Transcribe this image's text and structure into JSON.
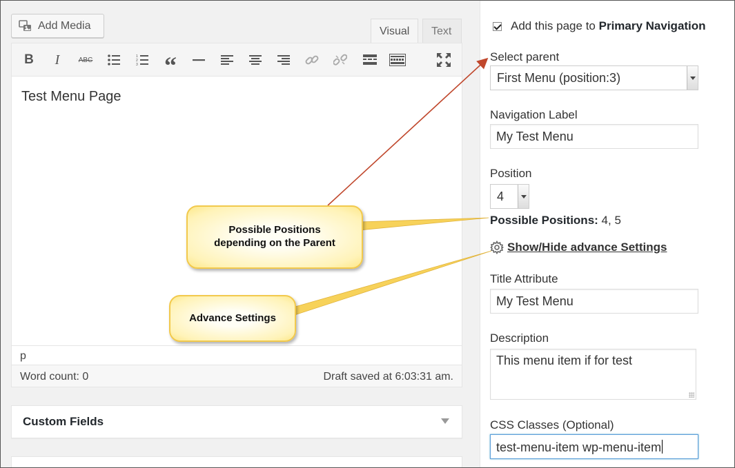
{
  "editor": {
    "add_media_label": "Add Media",
    "tabs": {
      "visual": "Visual",
      "text": "Text"
    },
    "toolbar": {
      "bold": "B",
      "italic": "I",
      "strikethrough": "ABC",
      "blockquote": "“",
      "icons": [
        "bold-icon",
        "italic-icon",
        "strikethrough-icon",
        "bullet-list-icon",
        "numbered-list-icon",
        "blockquote-icon",
        "horizontal-rule-icon",
        "align-left-icon",
        "align-center-icon",
        "align-right-icon",
        "link-icon",
        "unlink-icon",
        "read-more-icon",
        "toolbar-toggle-icon",
        "fullscreen-icon"
      ]
    },
    "content": "Test Menu Page",
    "path": "p",
    "word_count": "Word count: 0",
    "draft_saved": "Draft saved at 6:03:31 am."
  },
  "custom_fields": {
    "title": "Custom Fields"
  },
  "sidebar": {
    "add_to_nav_prefix": "Add this page to",
    "add_to_nav_target": "Primary Navigation",
    "select_parent_label": "Select parent",
    "select_parent_value": "First Menu (position:3)",
    "nav_label_label": "Navigation Label",
    "nav_label_value": "My Test Menu",
    "position_label": "Position",
    "position_value": "4",
    "possible_positions_label": "Possible Positions:",
    "possible_positions_value": "4, 5",
    "advance_settings_link": "Show/Hide advance Settings",
    "title_attr_label": "Title Attribute",
    "title_attr_value": "My Test Menu",
    "description_label": "Description",
    "description_value": "This menu item if for test",
    "css_classes_label": "CSS Classes (Optional)",
    "css_classes_value": "test-menu-item wp-menu-item"
  },
  "callouts": {
    "positions_line1": "Possible Positions",
    "positions_line2": "depending on the Parent",
    "advance": "Advance Settings"
  },
  "colors": {
    "arrow_red": "#c0472c",
    "arrow_yellow": "#f2c94c",
    "focus_blue": "#5b9dd9"
  }
}
